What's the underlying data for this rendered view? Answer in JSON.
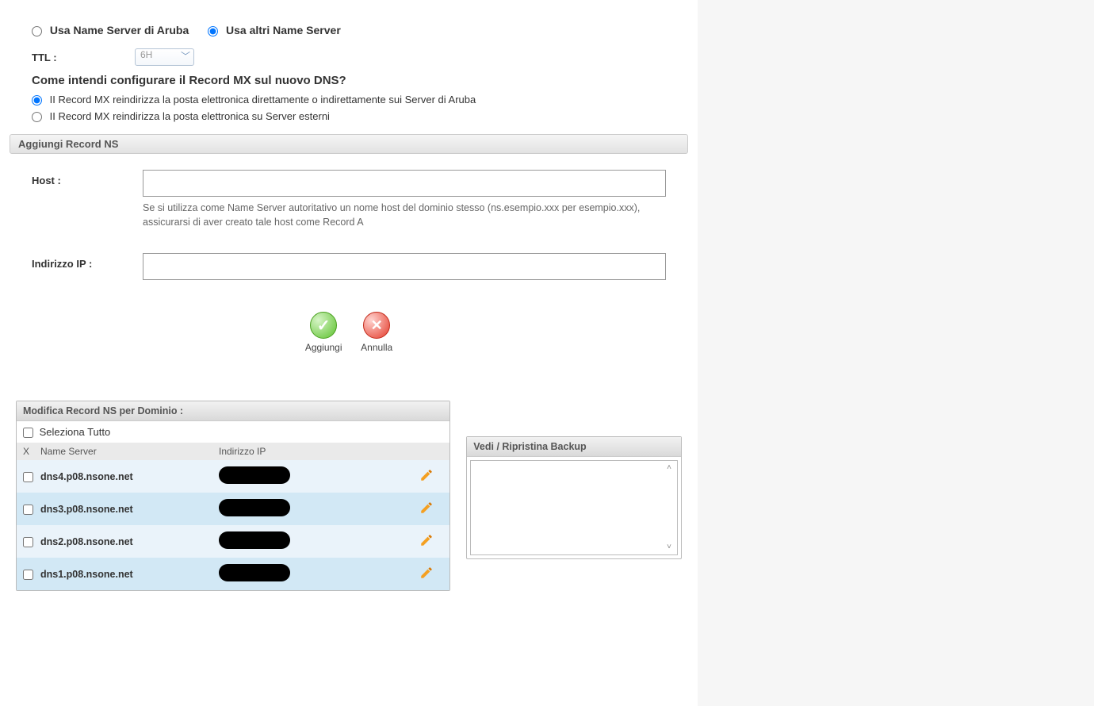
{
  "nameserver_choice": {
    "aruba_label": "Usa Name Server di Aruba",
    "other_label": "Usa altri Name Server",
    "selected": "other"
  },
  "ttl": {
    "label": "TTL :",
    "value": "6H"
  },
  "mx": {
    "question": "Come intendi configurare il Record MX sul nuovo DNS?",
    "opt_aruba": "II Record MX reindirizza la posta elettronica direttamente o indirettamente sui Server di Aruba",
    "opt_external": "II Record MX reindirizza la posta elettronica su Server esterni",
    "selected": "aruba"
  },
  "add_ns": {
    "section_title": "Aggiungi Record NS",
    "host_label": "Host :",
    "host_value": "",
    "host_help": "Se si utilizza come Name Server autoritativo un nome host del dominio stesso (ns.esempio.xxx per esempio.xxx), assicurarsi di aver creato tale host come Record A",
    "ip_label": "Indirizzo IP :",
    "ip_value": ""
  },
  "buttons": {
    "add": "Aggiungi",
    "cancel": "Annulla"
  },
  "ns_panel": {
    "title": "Modifica Record NS per Dominio :",
    "select_all": "Seleziona Tutto",
    "col_x": "X",
    "col_ns": "Name Server",
    "col_ip": "Indirizzo IP",
    "rows": [
      {
        "ns": "dns4.p08.nsone.net",
        "ip": "[redacted]"
      },
      {
        "ns": "dns3.p08.nsone.net",
        "ip": "[redacted]"
      },
      {
        "ns": "dns2.p08.nsone.net",
        "ip": "[redacted]"
      },
      {
        "ns": "dns1.p08.nsone.net",
        "ip": "[redacted]"
      }
    ]
  },
  "backup_panel": {
    "title": "Vedi / Ripristina Backup"
  }
}
